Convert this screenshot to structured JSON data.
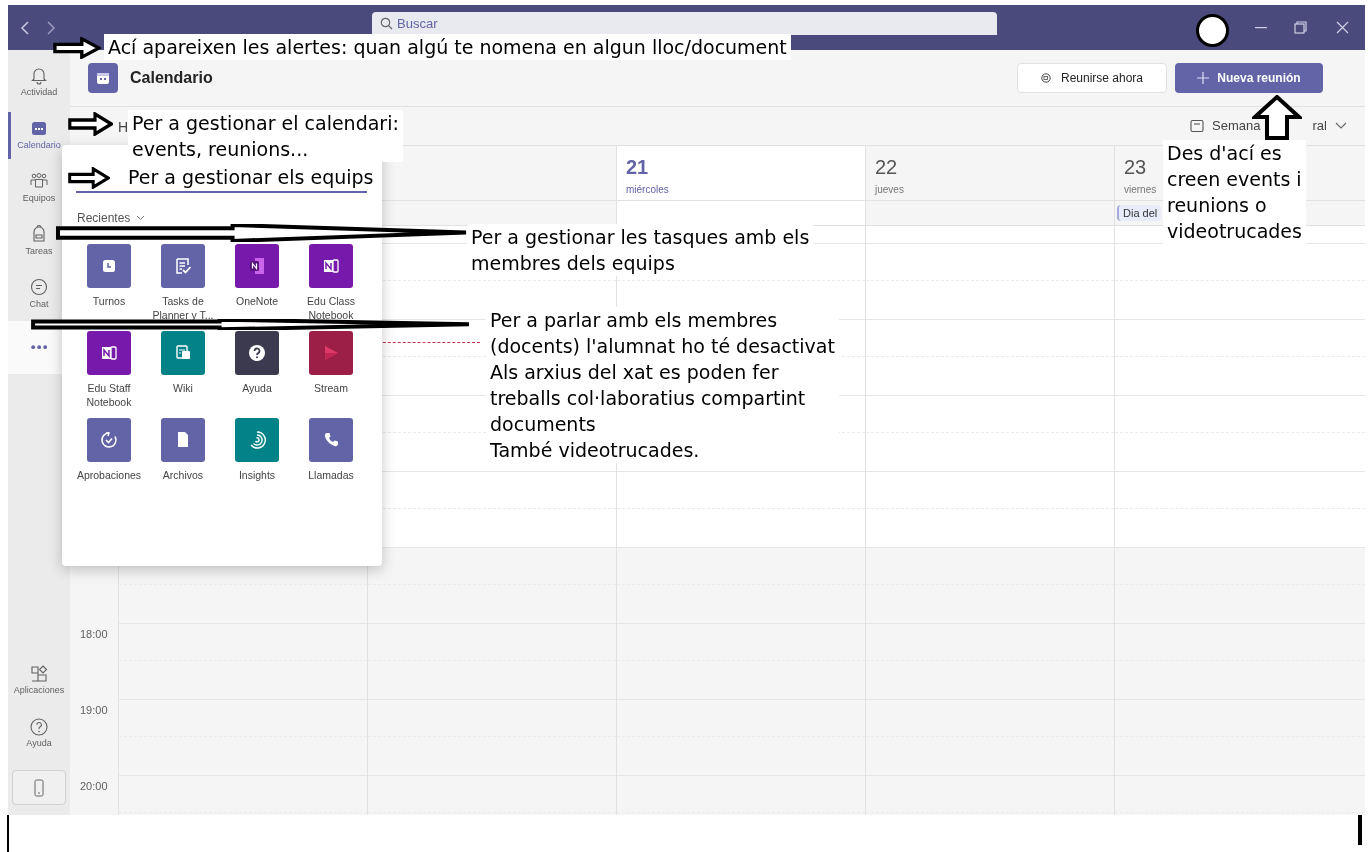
{
  "title_bar": {
    "search": {
      "placeholder": "Buscar"
    }
  },
  "rail": {
    "items": [
      {
        "kind": "bell",
        "label": "Actividad",
        "selected": false
      },
      {
        "kind": "calendar",
        "label": "Calendario",
        "selected": true
      },
      {
        "kind": "people",
        "label": "Equipos",
        "selected": false
      },
      {
        "kind": "backpack",
        "label": "Tareas",
        "selected": false
      },
      {
        "kind": "chat",
        "label": "Chat",
        "selected": false
      },
      {
        "kind": "more",
        "selected": false,
        "open": true
      }
    ],
    "bottom_items": [
      {
        "kind": "apps",
        "label": "Aplicaciones"
      },
      {
        "kind": "help",
        "label": "Ayuda"
      }
    ]
  },
  "header": {
    "title": "Calendario",
    "buttons": [
      {
        "kind": "secondary",
        "label": "Reunirse ahora"
      },
      {
        "kind": "primary",
        "label": "Nueva reunión"
      }
    ]
  },
  "toolbar": {
    "today": "H",
    "view_parts": [
      "Semana",
      "ral"
    ]
  },
  "days": [
    {
      "number": "21",
      "weekday": "miércoles",
      "today": true
    },
    {
      "number": "22",
      "weekday": "jueves",
      "today": false
    },
    {
      "number": "23",
      "weekday": "viernes",
      "today": false,
      "all_day_event": "Dia del"
    }
  ],
  "time_labels": [
    "18:00",
    "19:00",
    "20:00"
  ],
  "apps_panel": {
    "section": "Recientes",
    "apps": [
      {
        "kind": "clock",
        "label": "Turnos",
        "color": "#6264a7"
      },
      {
        "kind": "tasks",
        "label": "Tasks de Planner y T...",
        "color": "#6264a7"
      },
      {
        "kind": "onenote",
        "label": "OneNote",
        "color": "#7719aa"
      },
      {
        "kind": "notebook",
        "label": "Edu Class Notebook",
        "color": "#7719aa"
      },
      {
        "kind": "notebook",
        "label": "Edu Staff Notebook",
        "color": "#7719aa"
      },
      {
        "kind": "wiki",
        "label": "Wiki",
        "color": "#038387"
      },
      {
        "kind": "help",
        "label": "Ayuda",
        "color": "#3b3a4f"
      },
      {
        "kind": "stream",
        "label": "Stream",
        "color": "#9c1f48"
      },
      {
        "kind": "approvals",
        "label": "Aprobaciones",
        "color": "#6264a7"
      },
      {
        "kind": "file",
        "label": "Archivos",
        "color": "#6264a7"
      },
      {
        "kind": "insights",
        "label": "Insights",
        "color": "#038387"
      },
      {
        "kind": "phone",
        "label": "Llamadas",
        "color": "#6264a7"
      }
    ]
  },
  "annotations": [
    {
      "kind": "short",
      "paragraphs": [
        "Ací apareixen les alertes: quan algú te nomena en algun lloc/document"
      ]
    },
    {
      "kind": "short",
      "paragraphs": [
        "Per a gestionar el calendari:\nevents, reunions..."
      ]
    },
    {
      "kind": "short",
      "paragraphs": [
        "Per a gestionar els equips"
      ]
    },
    {
      "kind": "long",
      "paragraphs": [
        "Per a gestionar les tasques amb els\nmembres dels equips"
      ]
    },
    {
      "kind": "long",
      "paragraphs": [
        "Per a parlar amb els membres\n(docents) l'alumnat ho té desactivat",
        "Als arxius del xat es poden fer\ntreballs col·laboratius compartint\ndocuments",
        "També videotrucades."
      ]
    },
    {
      "kind": "up",
      "paragraphs": [
        "Des d'ací es\ncreen events i\nreunions o\nvideotrucades"
      ]
    }
  ]
}
